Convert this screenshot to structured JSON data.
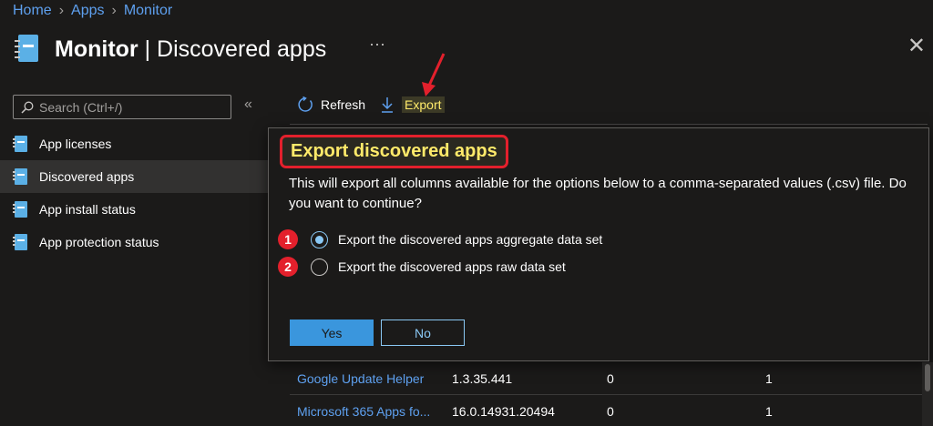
{
  "breadcrumb": {
    "home": "Home",
    "apps": "Apps",
    "monitor": "Monitor"
  },
  "header": {
    "title_bold": "Monitor",
    "title_rest": " | Discovered apps",
    "more": "···",
    "close": "✕"
  },
  "search": {
    "placeholder": "Search (Ctrl+/)"
  },
  "collapse": "«",
  "sidebar": {
    "items": [
      {
        "label": "App licenses"
      },
      {
        "label": "Discovered apps"
      },
      {
        "label": "App install status"
      },
      {
        "label": "App protection status"
      }
    ]
  },
  "toolbar": {
    "refresh_label": "Refresh",
    "export_label": "Export"
  },
  "dialog": {
    "title": "Export discovered apps",
    "message": "This will export all columns available for the options below to a comma-separated values (.csv) file. Do you want to continue?",
    "options": [
      {
        "num": "1",
        "label": "Export the discovered apps aggregate data set",
        "checked": true
      },
      {
        "num": "2",
        "label": "Export the discovered apps raw data set",
        "checked": false
      }
    ],
    "yes_label": "Yes",
    "no_label": "No"
  },
  "table": {
    "rows": [
      {
        "name": "Google Update Helper",
        "version": "1.3.35.441",
        "col3": "0",
        "col4": "1"
      },
      {
        "name": "Microsoft 365 Apps fo...",
        "version": "16.0.14931.20494",
        "col3": "0",
        "col4": "1"
      }
    ]
  },
  "colors": {
    "accent": "#3a96dd",
    "link": "#5ea0ef",
    "highlight": "#ffea6a",
    "annotation": "#e3202c"
  }
}
